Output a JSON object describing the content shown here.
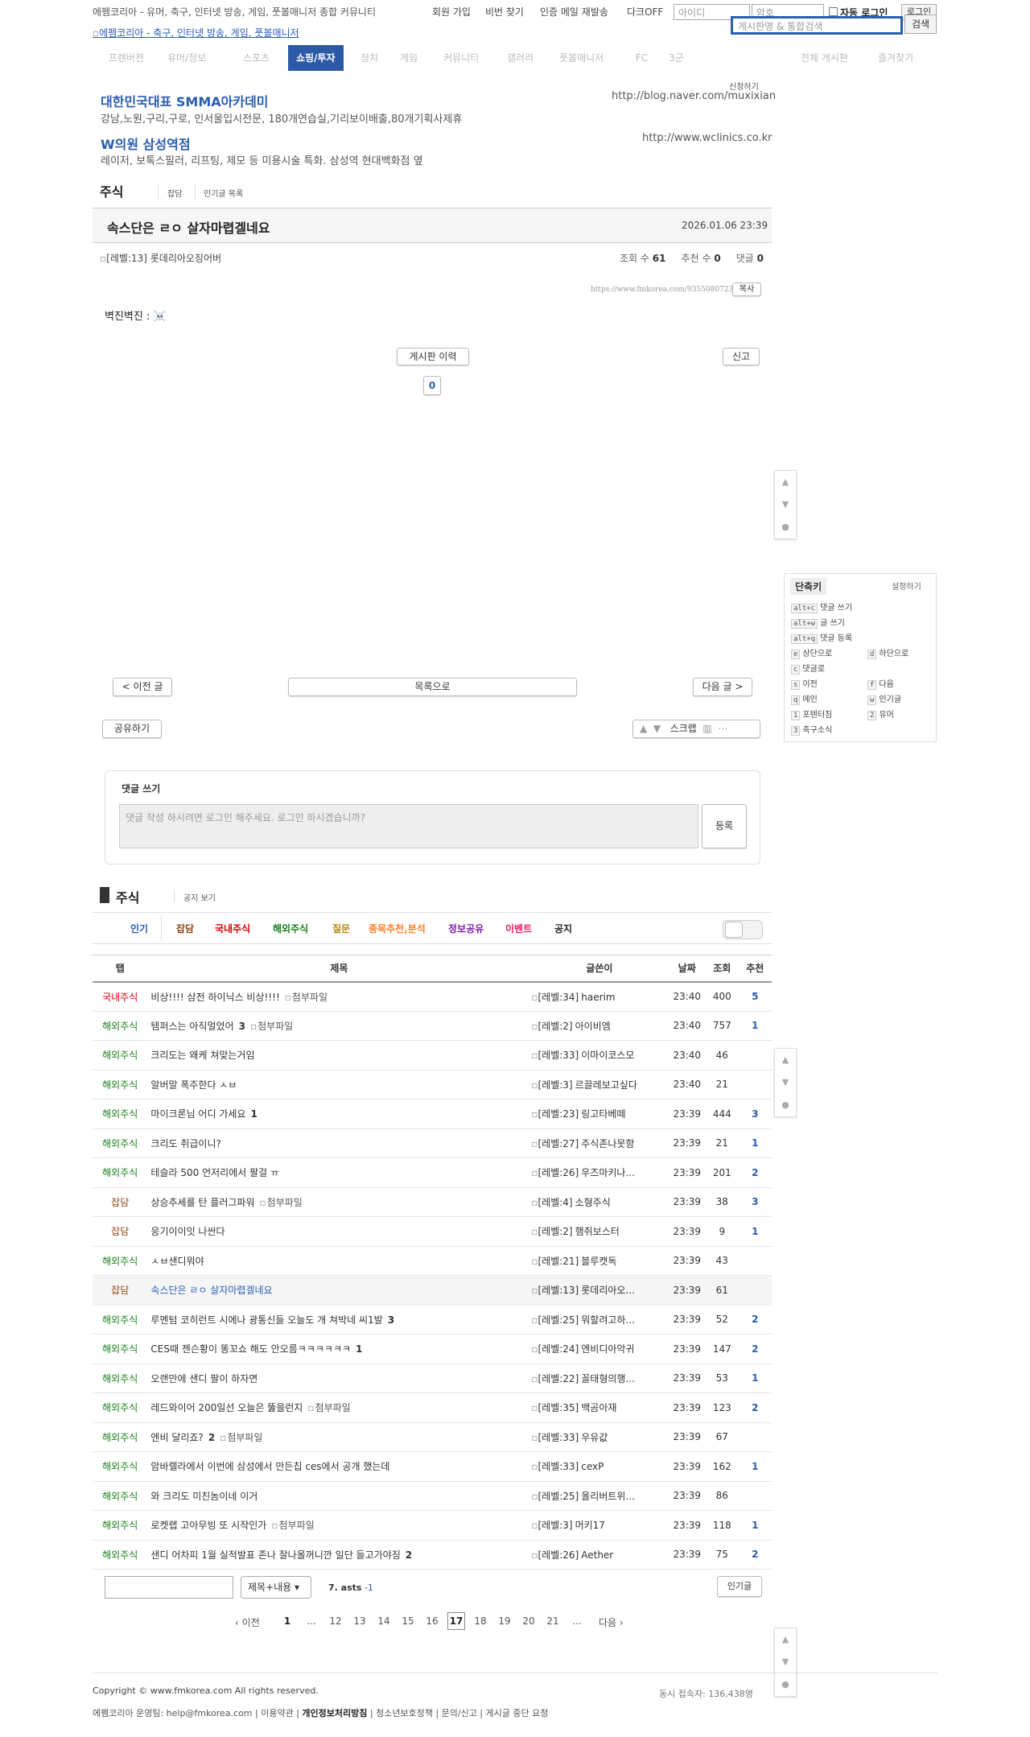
{
  "topbar": {
    "site_desc": "에펨코리아 - 유머, 축구, 인터넷 방송, 게임, 풋볼매니저 종합 커뮤니티",
    "links": [
      "회원 가입",
      "비번 찾기",
      "인증 메일 재발송",
      "다크OFF"
    ],
    "id_placeholder": "아이디",
    "pw_placeholder": "암호",
    "auto_login": "자동 로그인",
    "login": "로그인",
    "search_placeholder": "게시판명 & 통합검색",
    "search_btn": "검색"
  },
  "logo_alt": "에펨코리아 - 축구, 인터넷 방송, 게임, 풋볼매니저",
  "nav": [
    "프렌버젼",
    "유머/정보",
    "스포츠",
    "쇼핑/투자",
    "정치",
    "게임",
    "커뮤니티",
    "갤러리",
    "풋볼매니저",
    "FC",
    "3군",
    "전체 게시판",
    "즐겨찾기"
  ],
  "nav_active": "쇼핑/투자",
  "ads": {
    "apply": "신청하기",
    "items": [
      {
        "title": "대한민국대표 SMMA아카데미",
        "desc": "강남,노원,구리,구로, 인서울입시전문, 180개연습실,기리보이배출,80개기획사제휴",
        "url": "http://blog.naver.com/muxixian"
      },
      {
        "title": "W의원 삼성역점",
        "desc": "레이저, 보톡스필러, 리프팅, 제모 등 미용시술 특화. 삼성역 현대백화점 옆",
        "url": "http://www.wclinics.co.kr"
      }
    ]
  },
  "board": {
    "name": "주식",
    "links": [
      "잡담",
      "인기글 목록"
    ]
  },
  "post": {
    "title": "속스단은 ㄹㅇ 살자마렵겔네요",
    "date": "2026.01.06 23:39",
    "author_level": "[레벨:13]",
    "author": "롯데리아오징어버",
    "views_label": "조회 수",
    "views": "61",
    "rec_label": "추천 수",
    "rec": "0",
    "cmt_label": "댓글",
    "cmt": "0",
    "permalink": "https://www.fmkorea.com/9355080723",
    "copy": "복사",
    "body": "벽진벽진 : ☠️",
    "history_btn": "게시판 이력",
    "report_btn": "신고",
    "vote_count": "0"
  },
  "post_nav": {
    "prev": "< 이전 글",
    "list": "목록으로",
    "next": "다음 글 >"
  },
  "share": "공유하기",
  "scrap": "스크랩",
  "comment": {
    "title": "댓글 쓰기",
    "placeholder": "댓글 작성 하시려면 로그인 해주세요. 로그인 하시겠습니까?",
    "submit": "등록"
  },
  "list_header": {
    "board": "주식",
    "notice_link": "공지 보기"
  },
  "tabs": [
    {
      "label": "인기",
      "color": "#2a5db0"
    },
    {
      "label": "잡담",
      "color": "#8b4513"
    },
    {
      "label": "국내주식",
      "color": "#d40000"
    },
    {
      "label": "해외주식",
      "color": "#1a7f1a"
    },
    {
      "label": "질문",
      "color": "#b8860b"
    },
    {
      "label": "종목추천,분석",
      "color": "#ff7f27"
    },
    {
      "label": "정보공유",
      "color": "#7b1fa2"
    },
    {
      "label": "이벤트",
      "color": "#e91e63"
    },
    {
      "label": "공지",
      "color": "#222222"
    }
  ],
  "table": {
    "headers": [
      "탭",
      "제목",
      "글쓴이",
      "날짜",
      "조회",
      "추천"
    ],
    "attach_alt": "첨부파일",
    "rows": [
      {
        "cat": "국내주식",
        "cc": "#d40000",
        "title": "비상!!!! 삼전 하이닉스 비상!!!!",
        "cmt": "",
        "att": true,
        "lv": "[레벨:34]",
        "author": "haerim",
        "time": "23:40",
        "views": "400",
        "rec": "5"
      },
      {
        "cat": "해외주식",
        "cc": "#1a7f1a",
        "title": "템퍼스는 아직멀었어",
        "cmt": "3",
        "att": true,
        "lv": "[레벨:2]",
        "author": "아이비엠",
        "time": "23:40",
        "views": "757",
        "rec": "1"
      },
      {
        "cat": "해외주식",
        "cc": "#1a7f1a",
        "title": "크리도는 왜케 쳐맞는거임",
        "cmt": "",
        "att": false,
        "lv": "[레벨:33]",
        "author": "이마이코스모",
        "time": "23:40",
        "views": "46",
        "rec": ""
      },
      {
        "cat": "해외주식",
        "cc": "#1a7f1a",
        "title": "알버말 폭주한다 ㅅㅂ",
        "cmt": "",
        "att": false,
        "lv": "[레벨:3]",
        "author": "르끌레보고싶다",
        "time": "23:40",
        "views": "21",
        "rec": ""
      },
      {
        "cat": "해외주식",
        "cc": "#1a7f1a",
        "title": "마이크론님 어디 가세요",
        "cmt": "1",
        "att": false,
        "lv": "[레벨:23]",
        "author": "링고타베떼",
        "time": "23:39",
        "views": "444",
        "rec": "3"
      },
      {
        "cat": "해외주식",
        "cc": "#1a7f1a",
        "title": "크리도 취급이니?",
        "cmt": "",
        "att": false,
        "lv": "[레벨:27]",
        "author": "주식존나못함",
        "time": "23:39",
        "views": "21",
        "rec": "1"
      },
      {
        "cat": "해외주식",
        "cc": "#1a7f1a",
        "title": "테슬라 500 언저리에서 팔걸 ㅠ",
        "cmt": "",
        "att": false,
        "lv": "[레벨:26]",
        "author": "우즈마키나...",
        "time": "23:39",
        "views": "201",
        "rec": "2"
      },
      {
        "cat": "잡담",
        "cc": "#8b4513",
        "title": "상승추세를 탄 플러그파워",
        "cmt": "",
        "att": true,
        "lv": "[레벨:4]",
        "author": "소형주식",
        "time": "23:39",
        "views": "38",
        "rec": "3"
      },
      {
        "cat": "잡담",
        "cc": "#8b4513",
        "title": "응기이이잇 나싼다",
        "cmt": "",
        "att": false,
        "lv": "[레벨:2]",
        "author": "햄쥐보스터",
        "time": "23:39",
        "views": "9",
        "rec": "1"
      },
      {
        "cat": "해외주식",
        "cc": "#1a7f1a",
        "title": "ㅅㅂ샌디뭐야",
        "cmt": "",
        "att": false,
        "lv": "[레벨:21]",
        "author": "블루캣독",
        "time": "23:39",
        "views": "43",
        "rec": ""
      },
      {
        "cat": "잡담",
        "cc": "#8b4513",
        "title": "속스단은 ㄹㅇ 살자마렵겔네요",
        "cmt": "",
        "att": false,
        "lv": "[레벨:13]",
        "author": "롯데리아오...",
        "time": "23:39",
        "views": "61",
        "rec": "",
        "current": true
      },
      {
        "cat": "해외주식",
        "cc": "#1a7f1a",
        "title": "루멘텀 코히런트 시에나 광통신들 오늘도 개 쳐박네 씨1발",
        "cmt": "3",
        "att": false,
        "lv": "[레벨:25]",
        "author": "뭐할려고하...",
        "time": "23:39",
        "views": "52",
        "rec": "2"
      },
      {
        "cat": "해외주식",
        "cc": "#1a7f1a",
        "title": "CES때 젠슨황이 똥꼬쇼 해도 안오름ㅋㅋㅋㅋㅋㅋ",
        "cmt": "1",
        "att": false,
        "lv": "[레벨:24]",
        "author": "엔비디아악귀",
        "time": "23:39",
        "views": "147",
        "rec": "2"
      },
      {
        "cat": "해외주식",
        "cc": "#1a7f1a",
        "title": "오랜만에 샌디 팔이 하자면",
        "cmt": "",
        "att": false,
        "lv": "[레벨:22]",
        "author": "꼴태형의행...",
        "time": "23:39",
        "views": "53",
        "rec": "1"
      },
      {
        "cat": "해외주식",
        "cc": "#1a7f1a",
        "title": "레드와이어 200일선 오늘은 뚫을런지",
        "cmt": "",
        "att": true,
        "lv": "[레벨:35]",
        "author": "백곰아재",
        "time": "23:39",
        "views": "123",
        "rec": "2"
      },
      {
        "cat": "해외주식",
        "cc": "#1a7f1a",
        "title": "엔비 달리죠?",
        "cmt": "2",
        "att": true,
        "lv": "[레벨:33]",
        "author": "우유값",
        "time": "23:39",
        "views": "67",
        "rec": ""
      },
      {
        "cat": "해외주식",
        "cc": "#1a7f1a",
        "title": "암바렐라에서 이번에 삼성에서 만든칩 ces에서 공개 했는데",
        "cmt": "",
        "att": false,
        "lv": "[레벨:33]",
        "author": "cexP",
        "time": "23:39",
        "views": "162",
        "rec": "1"
      },
      {
        "cat": "해외주식",
        "cc": "#1a7f1a",
        "title": "와 크리도 미친놈이네 이거",
        "cmt": "",
        "att": false,
        "lv": "[레벨:25]",
        "author": "올리버트위...",
        "time": "23:39",
        "views": "86",
        "rec": ""
      },
      {
        "cat": "해외주식",
        "cc": "#1a7f1a",
        "title": "로켓랩 고아무빙 또 시작인가",
        "cmt": "",
        "att": true,
        "lv": "[레벨:3]",
        "author": "머키17",
        "time": "23:39",
        "views": "118",
        "rec": "1"
      },
      {
        "cat": "해외주식",
        "cc": "#1a7f1a",
        "title": "샌디 어차피 1월 실적발표 존나 잘나올꺼니깐 일단 들고가야징",
        "cmt": "2",
        "att": false,
        "lv": "[레벨:26]",
        "author": "Aether",
        "time": "23:39",
        "views": "75",
        "rec": "2"
      }
    ]
  },
  "search": {
    "select": "제목+내용",
    "stat": "7. asts",
    "stat_delta": "-1",
    "popular": "인기글"
  },
  "pagination": {
    "prev": "‹ 이전",
    "pages": [
      "1",
      "...",
      "12",
      "13",
      "14",
      "15",
      "16",
      "17",
      "18",
      "19",
      "20",
      "21",
      "..."
    ],
    "current": "17",
    "next": "다음 ›"
  },
  "shortcuts": {
    "title": "단축키",
    "setting": "설정하기",
    "items": [
      {
        "key": "alt+c",
        "label": "댓글 쓰기"
      },
      {
        "key": "alt+w",
        "label": "글 쓰기"
      },
      {
        "key": "alt+q",
        "label": "댓글 등록"
      },
      {
        "key": "e",
        "label": "상단으로"
      },
      {
        "key": "d",
        "label": "하단으로"
      },
      {
        "key": "c",
        "label": "댓글로"
      },
      {
        "key": "s",
        "label": "이전"
      },
      {
        "key": "f",
        "label": "다음"
      },
      {
        "key": "q",
        "label": "메인"
      },
      {
        "key": "w",
        "label": "인기글"
      },
      {
        "key": "1",
        "label": "포텐터짐"
      },
      {
        "key": "2",
        "label": "유머"
      },
      {
        "key": "3",
        "label": "축구소식"
      }
    ]
  },
  "footer": {
    "copyright": "Copyright © www.fmkorea.com All rights reserved.",
    "online": "동시 접속자: 136,438명",
    "links": [
      "에펨코리아 운영팀: help@fmkorea.com",
      "이용약관",
      "개인정보처리방침",
      "청소년보호정책",
      "문의/신고",
      "게시글 중단 요청"
    ]
  }
}
